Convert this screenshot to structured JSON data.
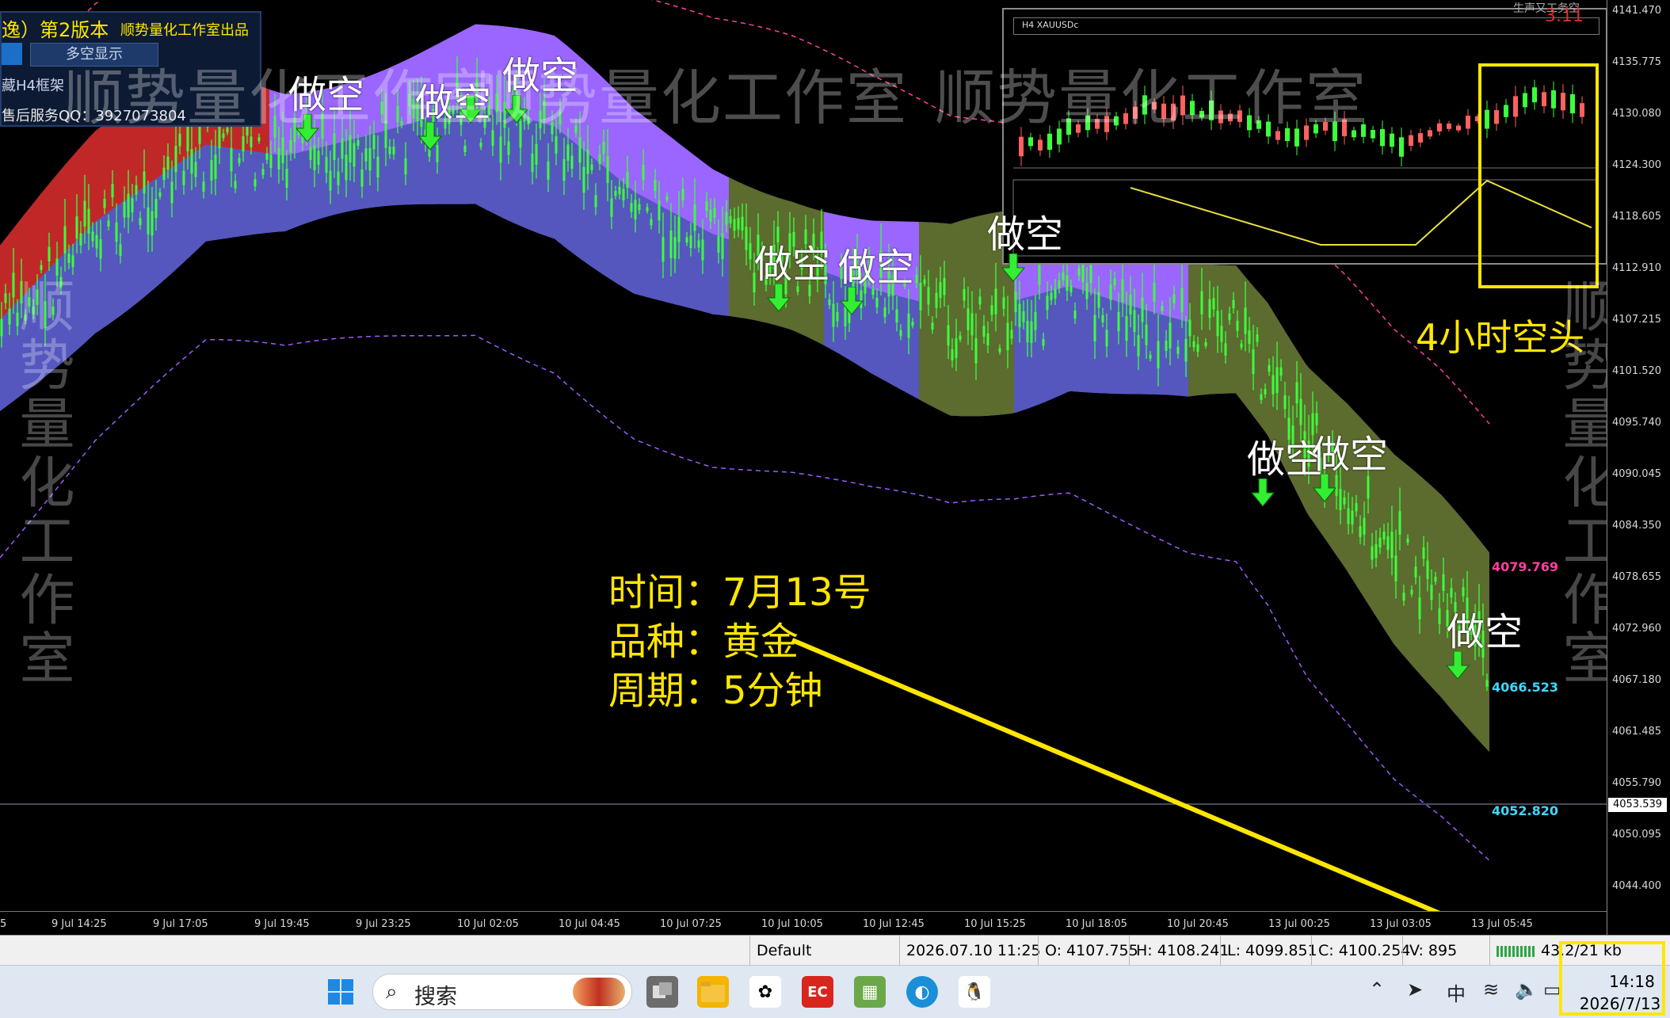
{
  "panel": {
    "title": "逸）第2版本",
    "subtitle": "顺势量化工作室出品",
    "ls_button": "多空显示",
    "h4_frame": "藏H4框架",
    "qq": "售后服务QQ：3927073804"
  },
  "inset": {
    "title": "H4 XAUUSDc"
  },
  "top_right": {
    "tag": "生声又工务空",
    "num": "3.11"
  },
  "short_label": "做空",
  "annotations": {
    "time": "时间：7月13号",
    "symbol": "品种：黄金",
    "period": "周期：5分钟",
    "trend": "4小时空头"
  },
  "watermark": "顺势量化工作室",
  "price_axis": {
    "ticks": [
      "4141.470",
      "4135.775",
      "4130.080",
      "4124.300",
      "4118.605",
      "4112.910",
      "4107.215",
      "4101.520",
      "4095.740",
      "4090.045",
      "4084.350",
      "4078.655",
      "4072.960",
      "4067.180",
      "4061.485",
      "4055.790",
      "4050.095",
      "4044.400"
    ],
    "upper_band_label": "4079.769",
    "mid_label": "4066.523",
    "lower_label": "4052.820",
    "current_price": "4053.539",
    "colors": {
      "upper": "#ff3fa0",
      "mid": "#3fd8ff",
      "lower": "#3fd8ff"
    }
  },
  "time_axis": {
    "ticks": [
      "5",
      "9 Jul 14:25",
      "9 Jul 17:05",
      "9 Jul 19:45",
      "9 Jul 23:25",
      "10 Jul 02:05",
      "10 Jul 04:45",
      "10 Jul 07:25",
      "10 Jul 10:05",
      "10 Jul 12:45",
      "10 Jul 15:25",
      "10 Jul 18:05",
      "10 Jul 20:45",
      "13 Jul 00:25",
      "13 Jul 03:05",
      "13 Jul 05:45"
    ]
  },
  "statusbar": {
    "profile": "Default",
    "datetime": "2026.07.10 11:25",
    "open": "O: 4107.755",
    "high": "H: 4108.241",
    "low": "L: 4099.851",
    "close": "C: 4100.254",
    "volume": "V: 895",
    "traffic": "43.2/21 kb"
  },
  "taskbar": {
    "search_label": "搜索",
    "ime": "中",
    "time": "14:18",
    "date": "2026/7/13"
  },
  "colors": {
    "candle": "#3cff3c",
    "cloud_purple": "#9a66ff",
    "cloud_blue": "#1e4a8a",
    "cloud_red": "#c02828",
    "cloud_olive": "#5c6b2e",
    "highlight": "#ffe600"
  }
}
